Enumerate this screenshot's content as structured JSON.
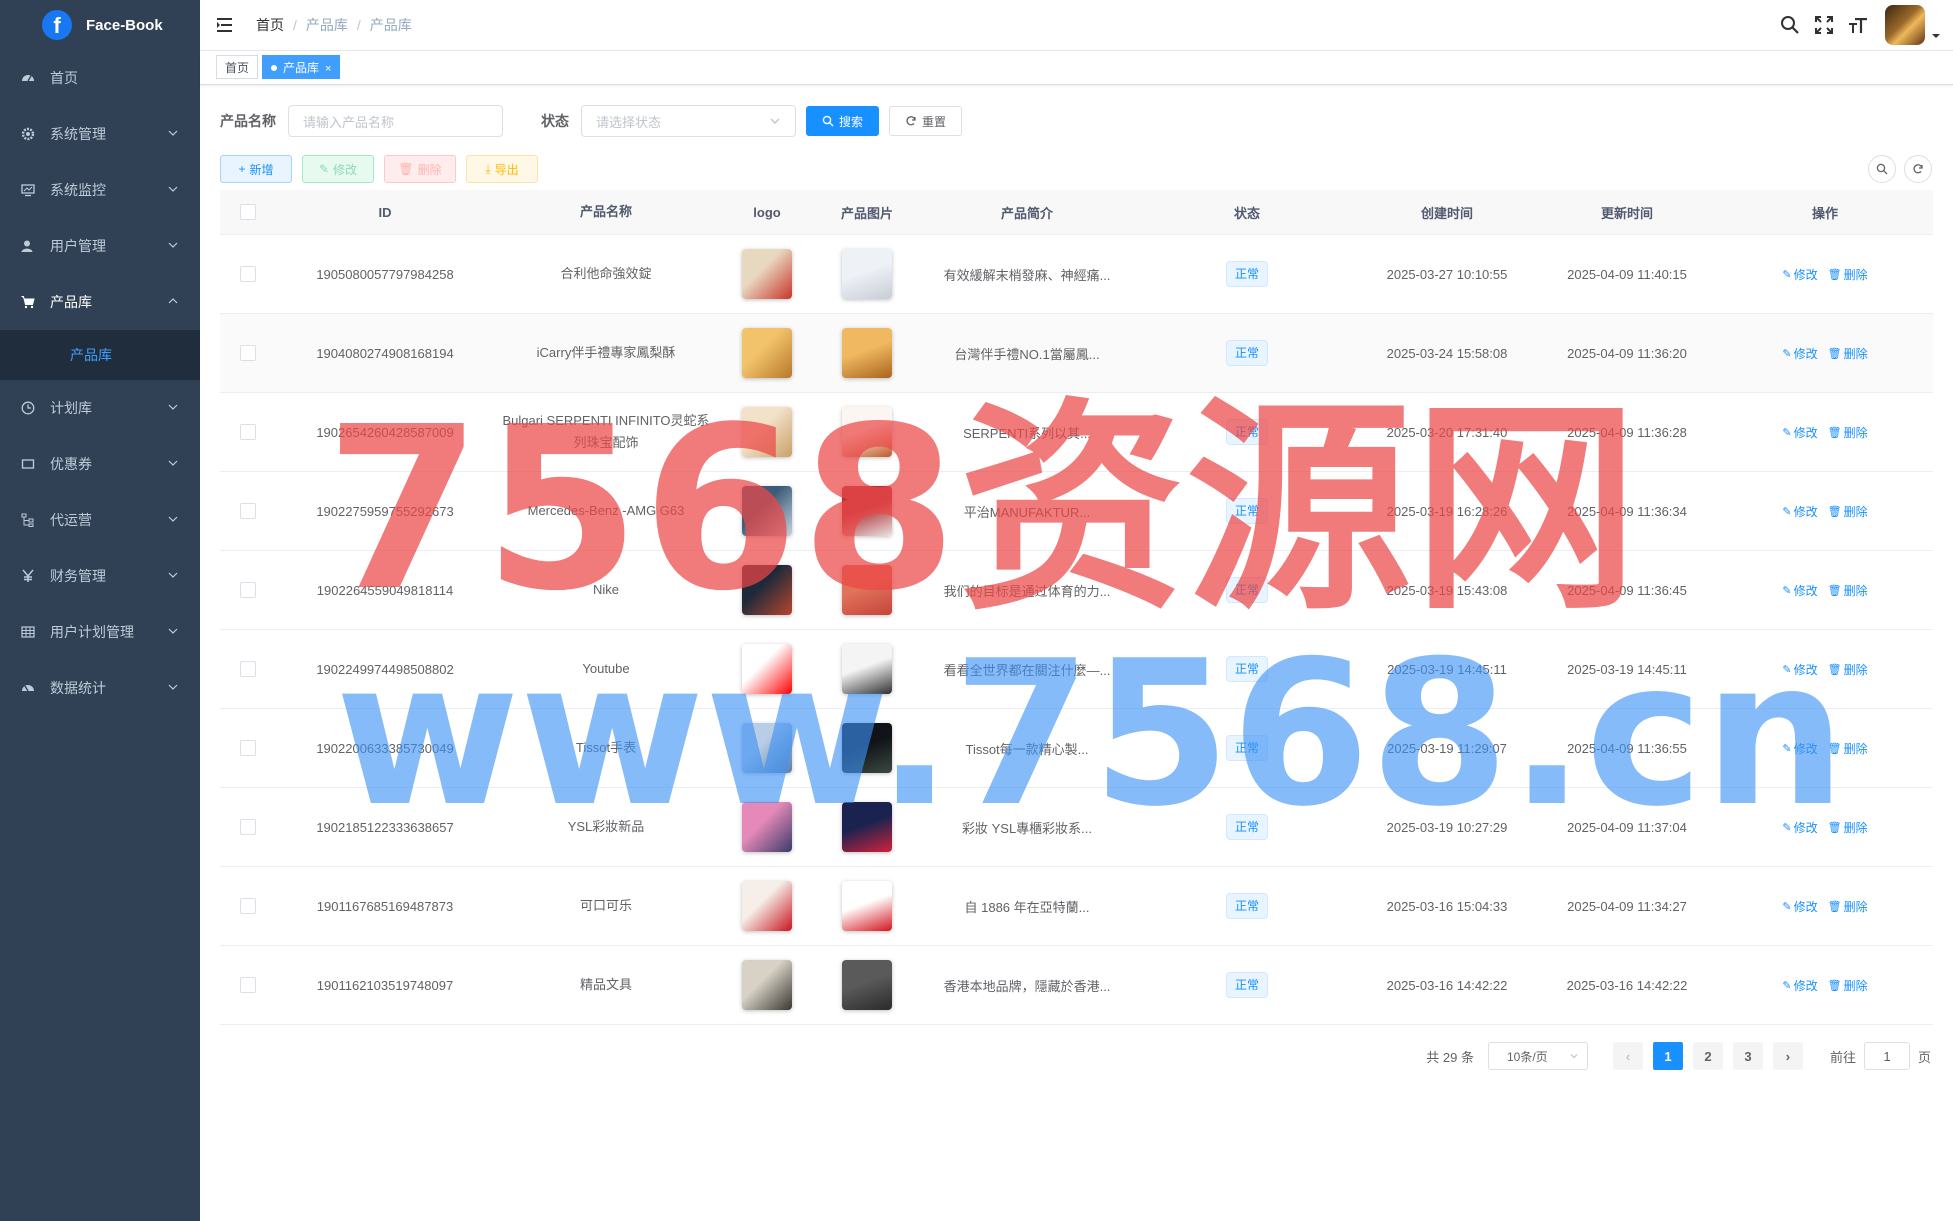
{
  "app": {
    "title": "Face-Book",
    "logo_letter": "f"
  },
  "sidebar": {
    "items": [
      {
        "label": "首页",
        "icon": "dashboard-icon",
        "has_children": false
      },
      {
        "label": "系统管理",
        "icon": "gear-icon",
        "has_children": true
      },
      {
        "label": "系统监控",
        "icon": "monitor-icon",
        "has_children": true
      },
      {
        "label": "用户管理",
        "icon": "user-icon",
        "has_children": true
      },
      {
        "label": "产品库",
        "icon": "cart-icon",
        "has_children": true,
        "expanded": true
      },
      {
        "label": "计划库",
        "icon": "clock-icon",
        "has_children": true
      },
      {
        "label": "优惠券",
        "icon": "coupon-icon",
        "has_children": true
      },
      {
        "label": "代运营",
        "icon": "tree-icon",
        "has_children": true
      },
      {
        "label": "财务管理",
        "icon": "yen-icon",
        "has_children": true
      },
      {
        "label": "用户计划管理",
        "icon": "grid-icon",
        "has_children": true
      },
      {
        "label": "数据统计",
        "icon": "chart-icon",
        "has_children": true
      }
    ],
    "submenu_active": "产品库"
  },
  "header": {
    "breadcrumb": [
      "首页",
      "产品库",
      "产品库"
    ],
    "icons": [
      "search-icon",
      "fullscreen-icon",
      "font-size-icon"
    ]
  },
  "tags": {
    "home": "首页",
    "active": "产品库",
    "close": "×"
  },
  "search_form": {
    "name_label": "产品名称",
    "name_placeholder": "请输入产品名称",
    "status_label": "状态",
    "status_placeholder": "请选择状态",
    "search_button": "搜索",
    "reset_button": "重置"
  },
  "toolbar": {
    "add": "新增",
    "edit": "修改",
    "delete": "删除",
    "export": "导出"
  },
  "table": {
    "columns": [
      "ID",
      "产品名称",
      "logo",
      "产品图片",
      "产品简介",
      "状态",
      "创建时间",
      "更新时间",
      "操作"
    ],
    "op_edit": "修改",
    "op_delete": "删除",
    "rows": [
      {
        "id": "1905080057797984258",
        "name": "合利他命強效錠",
        "desc": "有效緩解末梢發麻、神經痛...",
        "status": "正常",
        "created": "2025-03-27 10:10:55",
        "updated": "2025-04-09 11:40:15",
        "logo_colors": [
          "#e8d8c0",
          "#c8342a"
        ],
        "img_colors": [
          "#eef1f6",
          "#c8cdd6"
        ]
      },
      {
        "id": "1904080274908168194",
        "name": "iCarry伴手禮專家鳳梨酥",
        "desc": "台灣伴手禮NO.1當屬鳳...",
        "status": "正常",
        "created": "2025-03-24 15:58:08",
        "updated": "2025-04-09 11:36:20",
        "logo_colors": [
          "#f2c36b",
          "#b7782a"
        ],
        "img_colors": [
          "#f0b860",
          "#a8651e"
        ]
      },
      {
        "id": "1902654260428587009",
        "name": "Bulgari SERPENTI INFINITO灵蛇系列珠宝配饰",
        "desc": "SERPENTI系列以其...",
        "status": "正常",
        "created": "2025-03-20 17:31:40",
        "updated": "2025-04-09 11:36:28",
        "logo_colors": [
          "#f3e2c8",
          "#c9a06a"
        ],
        "img_colors": [
          "#fbf6f2",
          "#c25a2a"
        ]
      },
      {
        "id": "1902275959755292673",
        "name": "Mercedes-Benz -AMG G63",
        "desc": "平治MANUFAKTUR...",
        "status": "正常",
        "created": "2025-03-19 16:28:26",
        "updated": "2025-04-09 11:36:34",
        "logo_colors": [
          "#3b5d7a",
          "#c4d2dc"
        ],
        "img_colors": [
          "#b2343a",
          "#e8e2e0"
        ]
      },
      {
        "id": "1902264559049818114",
        "name": "Nike",
        "desc": "我们的目标是通过体育的力...",
        "status": "正常",
        "created": "2025-03-19 15:43:08",
        "updated": "2025-04-09 11:36:45",
        "logo_colors": [
          "#1e2a3a",
          "#b8452e"
        ],
        "img_colors": [
          "#e0735a",
          "#c5433a"
        ]
      },
      {
        "id": "1902249974498508802",
        "name": "Youtube",
        "desc": "看看全世界都在關注什麼—...",
        "status": "正常",
        "created": "2025-03-19 14:45:11",
        "updated": "2025-03-19 14:45:11",
        "logo_colors": [
          "#ffffff",
          "#ff0000"
        ],
        "img_colors": [
          "#f4f4f4",
          "#303030"
        ]
      },
      {
        "id": "1902200633385730049",
        "name": "Tissot手表",
        "desc": "Tissot每一款精心製...",
        "status": "正常",
        "created": "2025-03-19 11:29:07",
        "updated": "2025-04-09 11:36:55",
        "logo_colors": [
          "#b9cde6",
          "#5f7fa8"
        ],
        "img_colors": [
          "#101418",
          "#3a4a40"
        ]
      },
      {
        "id": "1902185122333638657",
        "name": "YSL彩妝新品",
        "desc": "彩妝 YSL專櫃彩妝系...",
        "status": "正常",
        "created": "2025-03-19 10:27:29",
        "updated": "2025-04-09 11:37:04",
        "logo_colors": [
          "#e58ab8",
          "#3a3a6a"
        ],
        "img_colors": [
          "#1a2350",
          "#d0223a"
        ]
      },
      {
        "id": "1901167685169487873",
        "name": "可口可乐",
        "desc": "自 1886 年在亞特蘭...",
        "status": "正常",
        "created": "2025-03-16 15:04:33",
        "updated": "2025-04-09 11:34:27",
        "logo_colors": [
          "#f6eee8",
          "#c8141e"
        ],
        "img_colors": [
          "#ffffff",
          "#d2141e"
        ]
      },
      {
        "id": "1901162103519748097",
        "name": "精品文具",
        "desc": "香港本地品牌，隱藏於香港...",
        "status": "正常",
        "created": "2025-03-16 14:42:22",
        "updated": "2025-03-16 14:42:22",
        "logo_colors": [
          "#d8d2c6",
          "#3a3632"
        ],
        "img_colors": [
          "#5a5a5a",
          "#2a2a2a"
        ]
      }
    ]
  },
  "pagination": {
    "total_text": "共 29 条",
    "page_size": "10条/页",
    "pages": [
      "1",
      "2",
      "3"
    ],
    "current": "1",
    "goto_label": "前往",
    "goto_value": "1",
    "page_unit": "页"
  },
  "watermark": {
    "line1": "7568资源网",
    "line2": "www.7568.cn"
  },
  "colors": {
    "sidebar_bg": "#304156",
    "submenu_bg": "#1f2d3d",
    "primary": "#1890ff",
    "active_tag": "#409eff"
  }
}
